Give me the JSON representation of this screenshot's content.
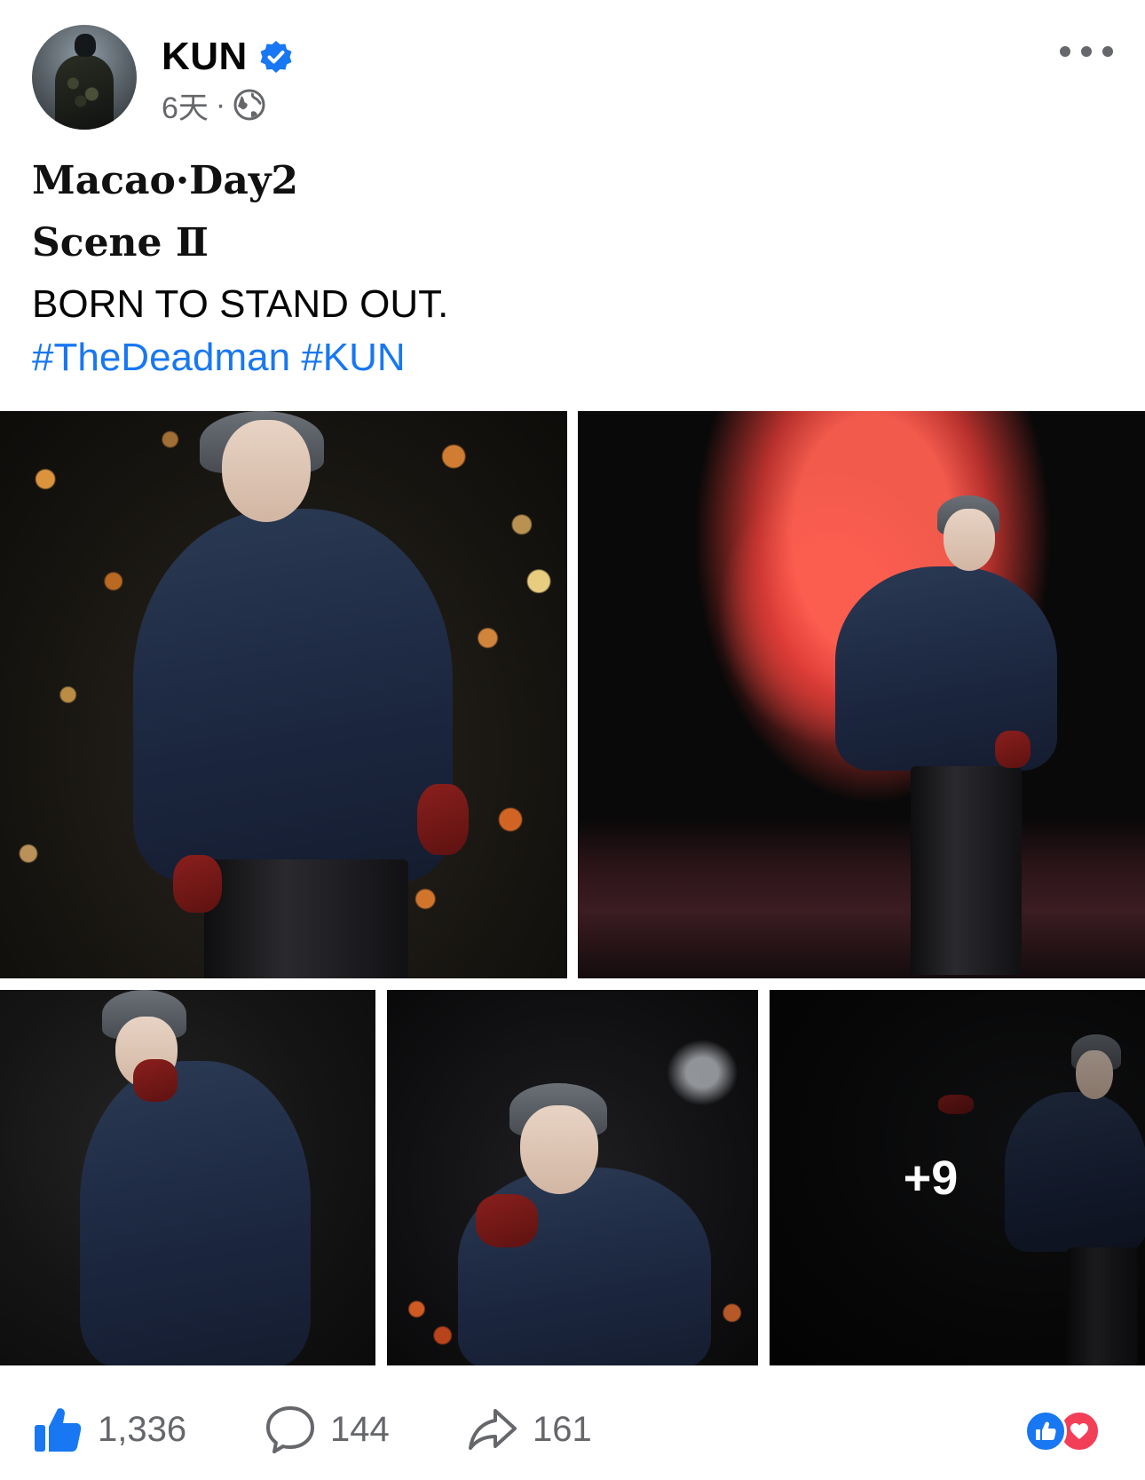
{
  "post": {
    "author": "KUN",
    "verified": true,
    "time": "6天",
    "separator": "·",
    "audience_icon": "globe-icon"
  },
  "caption": {
    "line1": "Macao·Day2",
    "line2": "Scene Ⅱ",
    "line3": "BORN TO STAND OUT.",
    "hashtags": [
      "#TheDeadman",
      "#KUN"
    ]
  },
  "photos": {
    "more_count": "+9"
  },
  "actions": {
    "likes": "1,336",
    "comments": "144",
    "shares": "161"
  },
  "reactions": [
    "like",
    "love"
  ],
  "colors": {
    "link": "#1877f2",
    "meta": "#65676b",
    "like": "#1877f2",
    "love": "#f33e58"
  }
}
